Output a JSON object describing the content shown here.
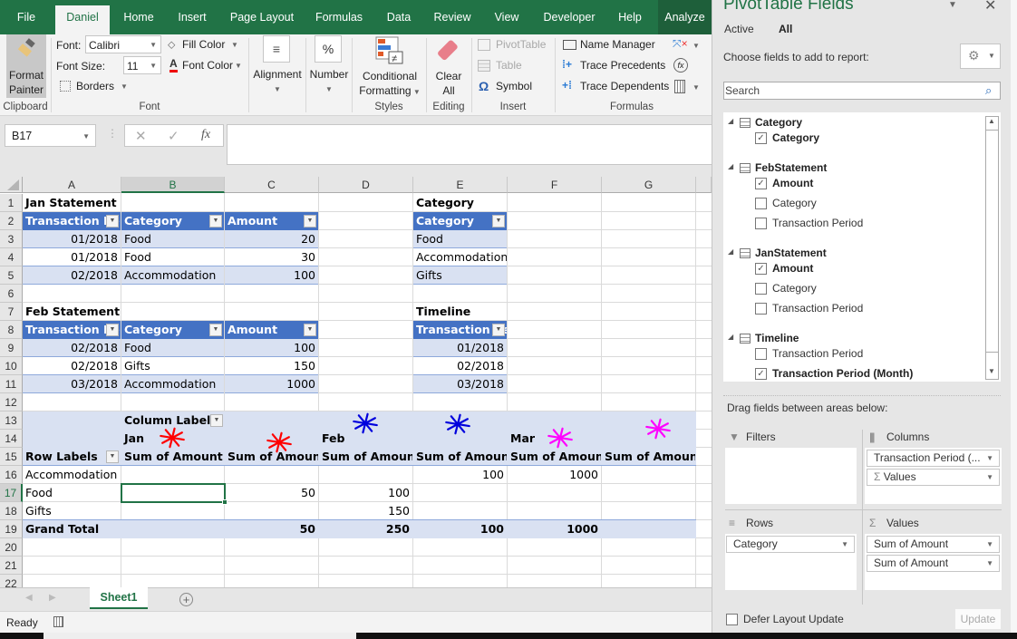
{
  "ribbon": {
    "tabs": [
      "File",
      "Daniel",
      "Home",
      "Insert",
      "Page Layout",
      "Formulas",
      "Data",
      "Review",
      "View",
      "Developer",
      "Help",
      "Analyze"
    ],
    "active_tab": "Daniel",
    "clipboard": {
      "format_painter": [
        "Format",
        "Painter"
      ],
      "group": "Clipboard"
    },
    "font": {
      "font_label": "Font:",
      "font_value": "Calibri",
      "size_label": "Font Size:",
      "size_value": "11",
      "fill_color": "Fill Color",
      "font_color": "Font Color",
      "borders": "Borders",
      "group": "Font"
    },
    "alignment": "Alignment",
    "number": "Number",
    "styles": {
      "conditional": [
        "Conditional",
        "Formatting"
      ],
      "group": "Styles"
    },
    "editing": {
      "clear": [
        "Clear",
        "All"
      ],
      "group": "Editing"
    },
    "insert": {
      "pivot": "PivotTable",
      "table": "Table",
      "symbol": "Symbol",
      "group": "Insert"
    },
    "formulas": {
      "name_manager": "Name Manager",
      "trace_precedents": "Trace Precedents",
      "trace_dependents": "Trace Dependents",
      "group": "Formulas"
    }
  },
  "formula_bar": {
    "name_box": "B17",
    "formula": ""
  },
  "columns": [
    "A",
    "B",
    "C",
    "D",
    "E",
    "F",
    "G"
  ],
  "selected_column": "B",
  "rows": [
    "1",
    "2",
    "3",
    "4",
    "5",
    "6",
    "7",
    "8",
    "9",
    "10",
    "11",
    "12",
    "13",
    "14",
    "15",
    "16",
    "17",
    "18",
    "19",
    "20",
    "21",
    "22"
  ],
  "selected_row": "17",
  "jan": {
    "title": "Jan Statement",
    "headers": [
      "Transaction Pe",
      "Category",
      "Amount"
    ],
    "rows": [
      [
        "01/2018",
        "Food",
        "20"
      ],
      [
        "01/2018",
        "Food",
        "30"
      ],
      [
        "02/2018",
        "Accommodation",
        "100"
      ]
    ]
  },
  "feb": {
    "title": "Feb Statement",
    "headers": [
      "Transaction Pe",
      "Category",
      "Amount"
    ],
    "rows": [
      [
        "02/2018",
        "Food",
        "100"
      ],
      [
        "02/2018",
        "Gifts",
        "150"
      ],
      [
        "03/2018",
        "Accommodation",
        "1000"
      ]
    ]
  },
  "category_table": {
    "title": "Category",
    "header": "Category",
    "rows": [
      "Food",
      "Accommodation",
      "Gifts"
    ]
  },
  "timeline_table": {
    "title": "Timeline",
    "header": "Transaction Pe",
    "rows": [
      "01/2018",
      "02/2018",
      "03/2018"
    ]
  },
  "pivot": {
    "column_labels": "Column Labels",
    "row_labels": "Row Labels",
    "months": [
      "Jan",
      "Feb",
      "Mar"
    ],
    "value_header": "Sum of Amount",
    "rows": [
      {
        "label": "Accommodation",
        "values": [
          "",
          "",
          "",
          "100",
          "1000",
          ""
        ]
      },
      {
        "label": "Food",
        "values": [
          "",
          "50",
          "100",
          "",
          "",
          ""
        ]
      },
      {
        "label": "Gifts",
        "values": [
          "",
          "",
          "150",
          "",
          "",
          ""
        ]
      }
    ],
    "grand_total": {
      "label": "Grand Total",
      "values": [
        "",
        "50",
        "250",
        "100",
        "1000",
        ""
      ]
    }
  },
  "annotations": {
    "colors": {
      "red": "#ff0000",
      "blue": "#0000dd",
      "magenta": "#ff00ff"
    }
  },
  "sheets": [
    "Sheet1"
  ],
  "status": "Ready",
  "pane": {
    "title": "PivotTable Fields",
    "tabs": [
      "Active",
      "All"
    ],
    "choose_label": "Choose fields to add to report:",
    "search_placeholder": "Search",
    "tables": [
      {
        "name": "Category",
        "fields": [
          {
            "name": "Category",
            "checked": true
          }
        ]
      },
      {
        "name": "FebStatement",
        "fields": [
          {
            "name": "Amount",
            "checked": true
          },
          {
            "name": "Category",
            "checked": false
          },
          {
            "name": "Transaction Period",
            "checked": false
          }
        ]
      },
      {
        "name": "JanStatement",
        "fields": [
          {
            "name": "Amount",
            "checked": true
          },
          {
            "name": "Category",
            "checked": false
          },
          {
            "name": "Transaction Period",
            "checked": false
          }
        ]
      },
      {
        "name": "Timeline",
        "fields": [
          {
            "name": "Transaction Period",
            "checked": false
          },
          {
            "name": "Transaction Period (Month)",
            "checked": true
          }
        ]
      }
    ],
    "drag_label": "Drag fields between areas below:",
    "areas": {
      "filters": {
        "label": "Filters",
        "items": []
      },
      "columns": {
        "label": "Columns",
        "items": [
          "Transaction Period (...",
          "Values"
        ]
      },
      "rows": {
        "label": "Rows",
        "items": [
          "Category"
        ]
      },
      "values": {
        "label": "Values",
        "items": [
          "Sum of Amount",
          "Sum of Amount"
        ]
      }
    },
    "defer_label": "Defer Layout Update",
    "update_label": "Update"
  }
}
